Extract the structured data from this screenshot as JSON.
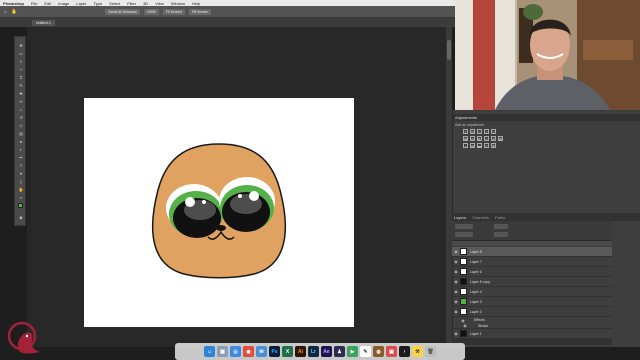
{
  "menubar": {
    "app": "Photoshop",
    "items": [
      "File",
      "Edit",
      "Image",
      "Layer",
      "Type",
      "Select",
      "Filter",
      "3D",
      "View",
      "Window",
      "Help"
    ]
  },
  "optbar": {
    "buttons": [
      "Scroll All Windows",
      "100%",
      "Fit Screen",
      "Fill Screen"
    ]
  },
  "document_tab": "Untitled-1",
  "toolbar": {
    "tools": [
      "move-icon",
      "marquee-icon",
      "lasso-icon",
      "magic-wand-icon",
      "crop-icon",
      "eyedropper-icon",
      "healing-icon",
      "brush-icon",
      "stamp-icon",
      "history-brush-icon",
      "eraser-icon",
      "gradient-icon",
      "blur-icon",
      "dodge-icon",
      "pen-icon",
      "type-icon",
      "path-select-icon",
      "shape-icon",
      "hand-icon",
      "zoom-icon"
    ]
  },
  "panels": {
    "adjustments_title": "Adjustments",
    "adjustments_subtitle": "Add an adjustment",
    "layers_tabs": [
      "Layers",
      "Channels",
      "Paths"
    ],
    "layers": [
      {
        "name": "Layer 8",
        "type": "white"
      },
      {
        "name": "Layer 7",
        "type": "white"
      },
      {
        "name": "Layer 6",
        "type": "white"
      },
      {
        "name": "Layer 5 copy",
        "type": "dark"
      },
      {
        "name": "Layer 4",
        "type": "white"
      },
      {
        "name": "Layer 3",
        "type": "green"
      },
      {
        "name": "Layer 2",
        "type": "white"
      },
      {
        "name": "Effects",
        "type": "fx"
      },
      {
        "name": "Stroke",
        "type": "fx"
      },
      {
        "name": "Layer 1",
        "type": "dark"
      }
    ]
  },
  "colors": {
    "accent": "#2d6cdf",
    "face": "#e0a261",
    "eye_green": "#55b04a",
    "logo": "#a3213a"
  },
  "dock": {
    "apps": [
      "Finder",
      "Launchpad",
      "Safari",
      "Chrome",
      "Mail",
      "Ps",
      "Excel",
      "Ai",
      "Lr",
      "Ae",
      "Ch",
      "Preview",
      "Word",
      "Photos",
      "Files",
      "Terminal",
      "Xcode",
      "Trash"
    ]
  }
}
